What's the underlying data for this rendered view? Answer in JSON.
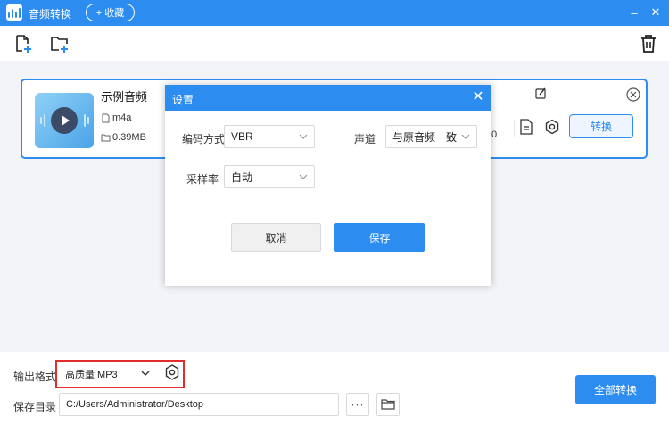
{
  "app": {
    "title": "音频转换",
    "favorite_label": "+ 收藏",
    "accent": "#2d8cf0"
  },
  "window_controls": {
    "minimize": "–",
    "close": "✕"
  },
  "toolbar": {
    "icons": [
      "add-file-icon",
      "add-folder-icon",
      "delete-icon"
    ]
  },
  "file": {
    "name": "示例音频",
    "format": "m4a",
    "size": "0.39MB",
    "partial_hidden_text": "0",
    "convert_label": "转换"
  },
  "settings_dialog": {
    "title": "设置",
    "encoding_label": "编码方式",
    "encoding_value": "VBR",
    "channel_label": "声道",
    "channel_value": "与原音频一致",
    "sample_rate_label": "采样率",
    "sample_rate_value": "自动",
    "cancel_label": "取消",
    "save_label": "保存"
  },
  "bottom": {
    "output_format_label": "输出格式",
    "output_format_value": "高质量 MP3",
    "save_dir_label": "保存目录",
    "save_dir_value": "C:/Users/Administrator/Desktop",
    "browse_label": "···",
    "convert_all_label": "全部转换",
    "highlight_color": "#e32d2d"
  }
}
